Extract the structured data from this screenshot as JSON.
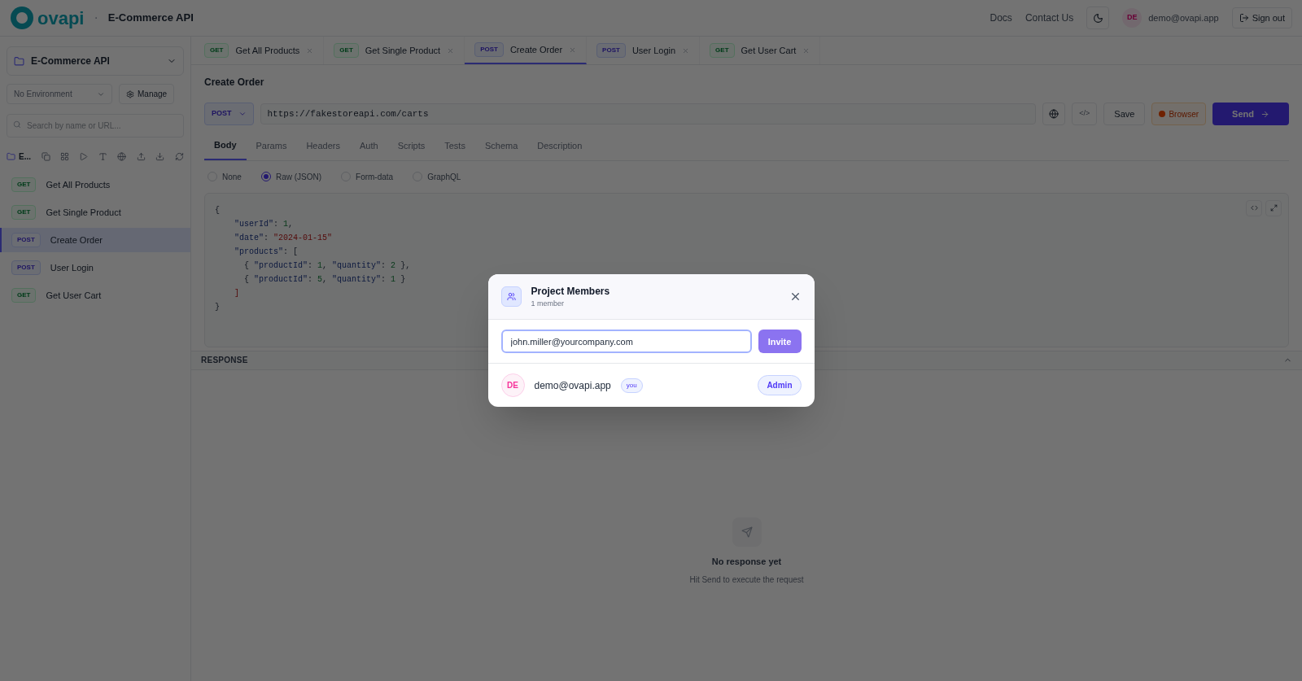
{
  "topbar": {
    "logo": "ovapi",
    "separator": "·",
    "project": "E-Commerce API",
    "links": [
      "Docs",
      "Contact Us"
    ],
    "user": {
      "initials": "DE",
      "email": "demo@ovapi.app"
    },
    "sign_out": "Sign out"
  },
  "sidebar": {
    "project": "E-Commerce API",
    "environment": "No Environment",
    "manage": "Manage",
    "search_placeholder": "Search by name or URL...",
    "collection": "E...",
    "items": [
      {
        "method": "GET",
        "name": "Get All Products",
        "selected": false
      },
      {
        "method": "GET",
        "name": "Get Single Product",
        "selected": false
      },
      {
        "method": "POST",
        "name": "Create Order",
        "selected": true
      },
      {
        "method": "POST",
        "name": "User Login",
        "selected": false
      },
      {
        "method": "GET",
        "name": "Get User Cart",
        "selected": false
      }
    ]
  },
  "tabs": [
    {
      "method": "GET",
      "label": "Get All Products",
      "selected": false
    },
    {
      "method": "GET",
      "label": "Get Single Product",
      "selected": false
    },
    {
      "method": "POST",
      "label": "Create Order",
      "selected": true
    },
    {
      "method": "POST",
      "label": "User Login",
      "selected": false
    },
    {
      "method": "GET",
      "label": "Get User Cart",
      "selected": false
    }
  ],
  "request": {
    "title": "Create Order",
    "method": "POST",
    "url": "https://fakestoreapi.com/carts",
    "code_button": "</>",
    "save": "Save",
    "browser": "Browser",
    "send": "Send",
    "subtabs": [
      {
        "label": "Body",
        "selected": true
      },
      {
        "label": "Params",
        "selected": false
      },
      {
        "label": "Headers",
        "selected": false
      },
      {
        "label": "Auth",
        "selected": false
      },
      {
        "label": "Scripts",
        "selected": false
      },
      {
        "label": "Tests",
        "selected": false
      },
      {
        "label": "Schema",
        "selected": false
      },
      {
        "label": "Description",
        "selected": false
      }
    ],
    "body_types": [
      {
        "label": "None",
        "selected": false
      },
      {
        "label": "Raw (JSON)",
        "selected": true
      },
      {
        "label": "Form-data",
        "selected": false
      },
      {
        "label": "GraphQL",
        "selected": false
      }
    ],
    "code": [
      [
        {
          "kind": "punct",
          "text": "{"
        }
      ],
      [
        {
          "kind": "key",
          "text": "    \"userId\""
        },
        {
          "kind": "punct",
          "text": ": "
        },
        {
          "kind": "number",
          "text": "1"
        },
        {
          "kind": "punct",
          "text": ","
        }
      ],
      [
        {
          "kind": "key",
          "text": "    \"date\""
        },
        {
          "kind": "punct",
          "text": ": "
        },
        {
          "kind": "string",
          "text": "\"2024-01-15\""
        }
      ],
      [
        {
          "kind": "key",
          "text": "    \"products\""
        },
        {
          "kind": "punct",
          "text": ": ["
        }
      ],
      [
        {
          "kind": "punct",
          "text": "      { "
        },
        {
          "kind": "key",
          "text": "\"productId\""
        },
        {
          "kind": "punct",
          "text": ": "
        },
        {
          "kind": "number",
          "text": "1"
        },
        {
          "kind": "punct",
          "text": ", "
        },
        {
          "kind": "key",
          "text": "\"quantity\""
        },
        {
          "kind": "punct",
          "text": ": "
        },
        {
          "kind": "number",
          "text": "2"
        },
        {
          "kind": "punct",
          "text": " },"
        }
      ],
      [
        {
          "kind": "punct",
          "text": "      { "
        },
        {
          "kind": "key",
          "text": "\"productId\""
        },
        {
          "kind": "punct",
          "text": ": "
        },
        {
          "kind": "number",
          "text": "5"
        },
        {
          "kind": "punct",
          "text": ", "
        },
        {
          "kind": "key",
          "text": "\"quantity\""
        },
        {
          "kind": "punct",
          "text": ": "
        },
        {
          "kind": "number",
          "text": "1"
        },
        {
          "kind": "punct",
          "text": " }"
        }
      ],
      [
        {
          "kind": "bracket",
          "text": "    ]"
        }
      ],
      [
        {
          "kind": "punct",
          "text": "}"
        }
      ]
    ]
  },
  "response": {
    "label": "RESPONSE",
    "empty_title": "No response yet",
    "empty_hint": "Hit Send to execute the request"
  },
  "dialog": {
    "title": "Project Members",
    "subtitle": "1 member",
    "invite_value": "john.miller@yourcompany.com",
    "invite": "Invite",
    "members": [
      {
        "initials": "DE",
        "email": "demo@ovapi.app",
        "badge": "you",
        "role": "Admin"
      }
    ]
  }
}
